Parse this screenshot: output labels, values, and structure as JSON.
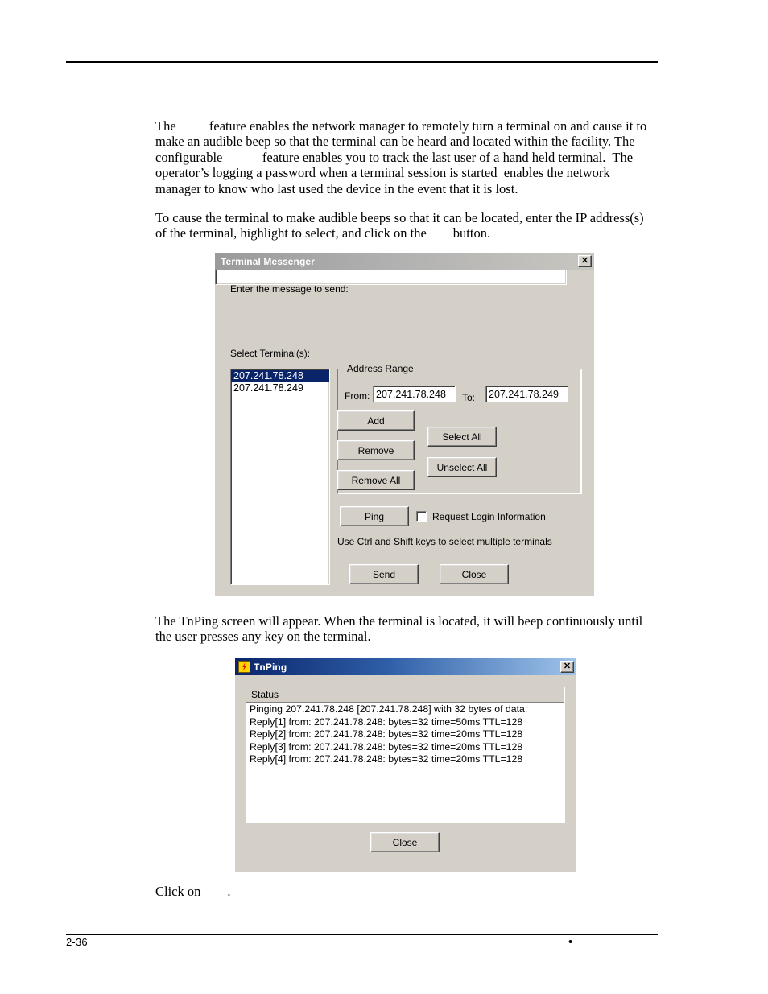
{
  "document": {
    "paragraphs": {
      "p1": "The          feature enables the network manager to remotely turn a terminal on and cause it to make an audible beep so that the terminal can be heard and located within the facility. The configurable            feature enables you to track the last user of a hand held terminal.  The operator’s logging a password when a terminal session is started  enables the network manager to know who last used the device in the event that it is lost.",
      "p2": "To cause the terminal to make audible beeps so that it can be located, enter the IP address(s) of the terminal, highlight to select, and click on the        button.",
      "p3": "The TnPing screen will appear. When the terminal is located, it will beep continuously until the user presses any key on the terminal.",
      "p4": "Click on        ."
    },
    "footer": {
      "page_number": "2-36",
      "bullet": "•"
    }
  },
  "terminal_messenger": {
    "title": "Terminal Messenger",
    "close_label": "✕",
    "message_label": "Enter the message to send:",
    "message_value": "",
    "select_terminals_label": "Select Terminal(s):",
    "terminal_list": [
      {
        "address": "207.241.78.248",
        "selected": true
      },
      {
        "address": "207.241.78.249",
        "selected": false
      }
    ],
    "address_range": {
      "group_title": "Address Range",
      "from_label": "From:",
      "from_value": "207.241.78.248",
      "to_label": "To:",
      "to_value": "207.241.78.249",
      "buttons": {
        "add": "Add",
        "remove": "Remove",
        "remove_all": "Remove All",
        "select_all": "Select All",
        "unselect_all": "Unselect All"
      }
    },
    "ping_button": "Ping",
    "request_login_label": "Request Login Information",
    "request_login_checked": false,
    "hint": "Use Ctrl and Shift keys to select multiple terminals",
    "send_button": "Send",
    "close_button": "Close",
    "colors": {
      "dialog_face": "#d4d0c8",
      "selection": "#0a246a",
      "title_start": "#9a9a9a",
      "title_end": "#c8c6c0"
    }
  },
  "tnping": {
    "title": "TnPing",
    "icon": "lightning-bolt-icon",
    "close_label": "✕",
    "status_group_title": "Status",
    "status_lines": [
      "Pinging 207.241.78.248 [207.241.78.248] with 32 bytes of data:",
      "Reply[1] from: 207.241.78.248: bytes=32 time=50ms TTL=128",
      "Reply[2] from: 207.241.78.248: bytes=32 time=20ms TTL=128",
      "Reply[3] from: 207.241.78.248: bytes=32 time=20ms TTL=128",
      "Reply[4] from: 207.241.78.248: bytes=32 time=20ms TTL=128"
    ],
    "close_button": "Close",
    "colors": {
      "title_start": "#0a246a",
      "title_end": "#9fc4ea",
      "icon_bg": "#ffd400",
      "icon_bolt": "#e01b00"
    }
  }
}
